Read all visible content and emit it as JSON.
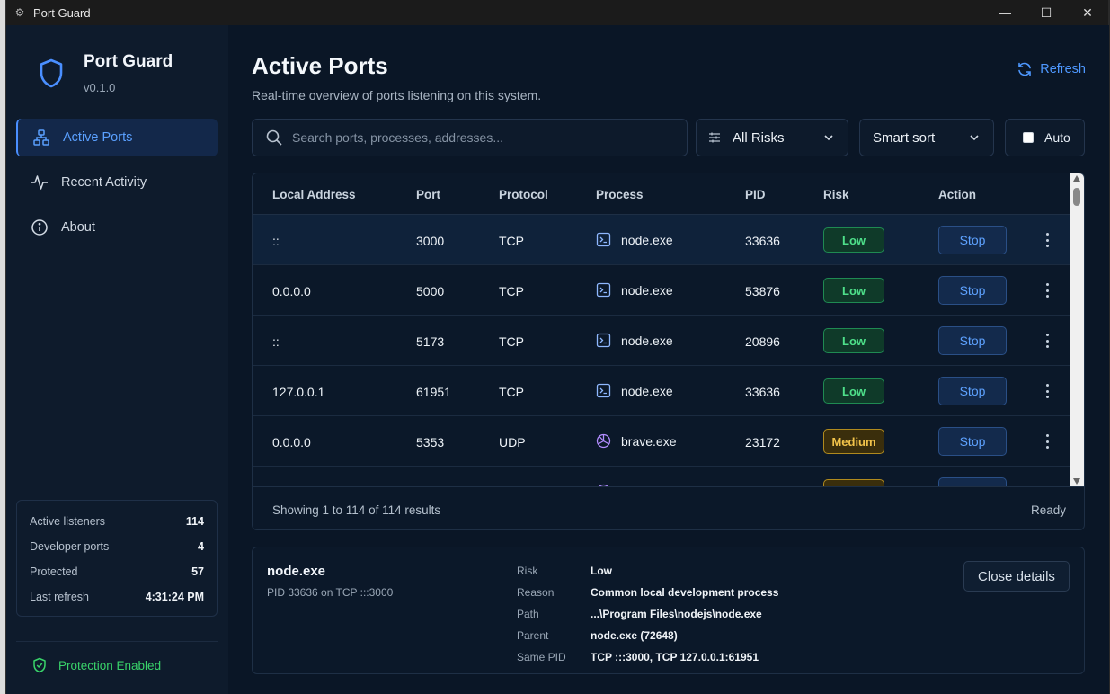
{
  "window": {
    "title": "Port Guard",
    "controls": [
      "—",
      "☐",
      "✕"
    ]
  },
  "brand": {
    "name": "Port Guard",
    "version": "v0.1.0"
  },
  "nav": [
    {
      "label": "Active Ports",
      "icon": "network-icon",
      "active": true
    },
    {
      "label": "Recent Activity",
      "icon": "activity-icon",
      "active": false
    },
    {
      "label": "About",
      "icon": "info-icon",
      "active": false
    }
  ],
  "stats": [
    {
      "label": "Active listeners",
      "value": "114"
    },
    {
      "label": "Developer ports",
      "value": "4"
    },
    {
      "label": "Protected",
      "value": "57"
    },
    {
      "label": "Last refresh",
      "value": "4:31:24 PM"
    }
  ],
  "protection": "Protection Enabled",
  "header": {
    "title": "Active Ports",
    "subtitle": "Real-time overview of ports listening on this system.",
    "refresh": "Refresh"
  },
  "toolbar": {
    "search_placeholder": "Search ports, processes, addresses...",
    "risk_filter": "All Risks",
    "sort": "Smart sort",
    "auto_label": "Auto"
  },
  "table": {
    "columns": [
      "Local Address",
      "Port",
      "Protocol",
      "Process",
      "PID",
      "Risk",
      "Action"
    ],
    "rows": [
      {
        "address": "::",
        "port": "3000",
        "protocol": "TCP",
        "process": "node.exe",
        "process_icon": "terminal-icon",
        "pid": "33636",
        "risk": "Low",
        "action": "Stop"
      },
      {
        "address": "0.0.0.0",
        "port": "5000",
        "protocol": "TCP",
        "process": "node.exe",
        "process_icon": "terminal-icon",
        "pid": "53876",
        "risk": "Low",
        "action": "Stop"
      },
      {
        "address": "::",
        "port": "5173",
        "protocol": "TCP",
        "process": "node.exe",
        "process_icon": "terminal-icon",
        "pid": "20896",
        "risk": "Low",
        "action": "Stop"
      },
      {
        "address": "127.0.0.1",
        "port": "61951",
        "protocol": "TCP",
        "process": "node.exe",
        "process_icon": "terminal-icon",
        "pid": "33636",
        "risk": "Low",
        "action": "Stop"
      },
      {
        "address": "0.0.0.0",
        "port": "5353",
        "protocol": "UDP",
        "process": "brave.exe",
        "process_icon": "browser-icon",
        "pid": "23172",
        "risk": "Medium",
        "action": "Stop"
      }
    ],
    "footer_showing": "Showing 1 to 114 of 114 results",
    "footer_status": "Ready"
  },
  "details": {
    "name": "node.exe",
    "subtitle": "PID 33636 on TCP :::3000",
    "fields": [
      {
        "key": "Risk",
        "value": "Low"
      },
      {
        "key": "Reason",
        "value": "Common local development process"
      },
      {
        "key": "Path",
        "value": "...\\Program Files\\nodejs\\node.exe"
      },
      {
        "key": "Parent",
        "value": "node.exe (72648)"
      },
      {
        "key": "Same PID",
        "value": "TCP :::3000, TCP 127.0.0.1:61951"
      }
    ],
    "close_label": "Close details"
  },
  "colors": {
    "accent": "#4e98ff",
    "low": "#4ee08a",
    "medium": "#f0c24a",
    "protection": "#39d36a"
  }
}
